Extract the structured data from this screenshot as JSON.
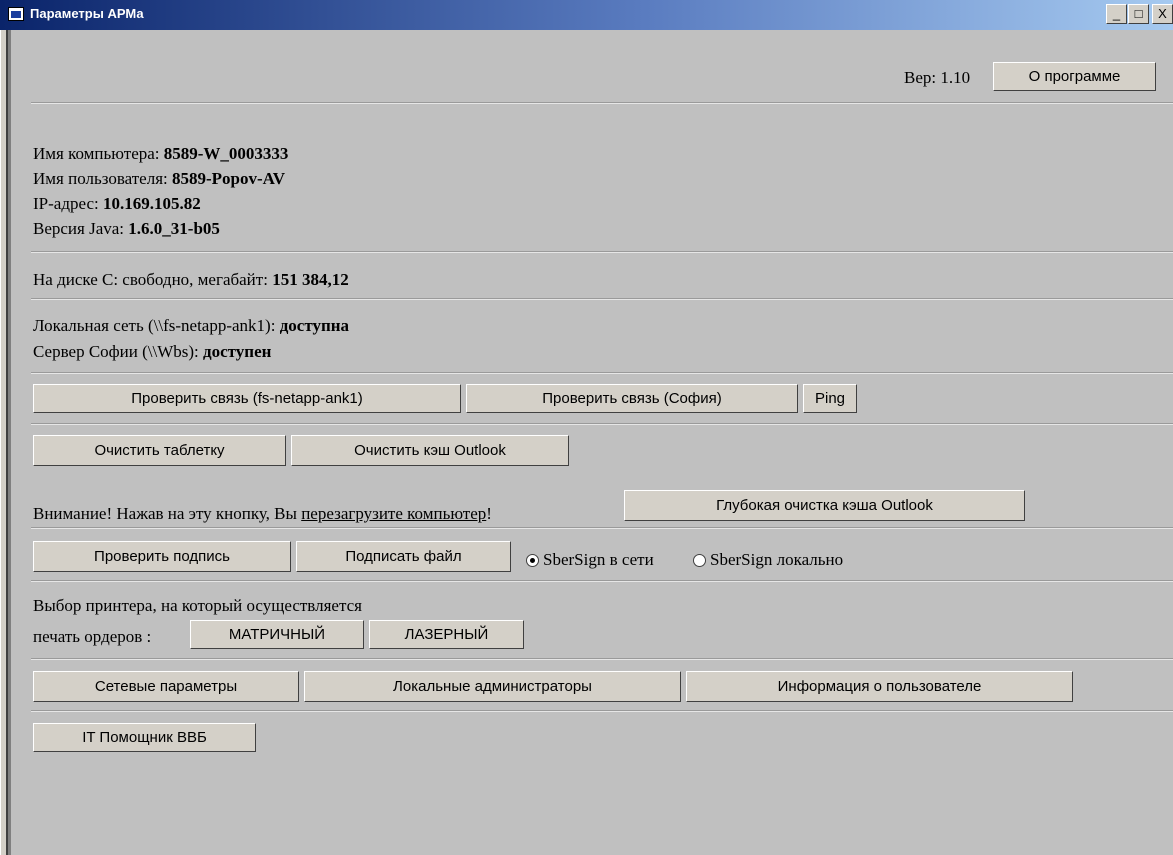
{
  "window": {
    "title": "Параметры АРМа",
    "controls": {
      "minimize": "_",
      "maximize": "□",
      "close": "X"
    }
  },
  "header": {
    "version_label": "Вер: 1.10",
    "about_button": "О программе"
  },
  "info": {
    "computer_name_label": "Имя компьютера: ",
    "computer_name": "8589-W_0003333",
    "user_name_label": "Имя пользователя: ",
    "user_name": "8589-Popov-AV",
    "ip_label": "IP-адрес: ",
    "ip": "10.169.105.82",
    "java_label": "Версия Java: ",
    "java": "1.6.0_31-b05"
  },
  "disk": {
    "label": "На диске C: свободно, мегабайт: ",
    "value": "151 384,12"
  },
  "network": {
    "local_label": "Локальная сеть (\\\\fs-netapp-ank1): ",
    "local_status": "доступна",
    "sofia_label": "Сервер Софии (\\\\Wbs): ",
    "sofia_status": "доступен"
  },
  "buttons_row1": {
    "check_fs": "Проверить связь (fs-netapp-ank1)",
    "check_sofia": "Проверить связь (София)",
    "ping": "Ping"
  },
  "buttons_row2": {
    "clear_tablet": "Очистить таблетку",
    "clear_outlook": "Очистить кэш Outlook"
  },
  "warning": {
    "text_before": "Внимание! Нажав на эту кнопку, Вы ",
    "link": "перезагрузите компьютер",
    "text_after": "!",
    "deep_clean_button": "Глубокая очистка кэша Outlook"
  },
  "sign": {
    "check_button": "Проверить подпись",
    "sign_button": "Подписать файл",
    "radio_network": "SberSign в сети",
    "radio_local": "SberSign локально",
    "selected": "SberSign в сети"
  },
  "printer": {
    "label_line1": "Выбор принтера, на который осуществляется",
    "label_line2": "печать ордеров :",
    "matrix_button": "МАТРИЧНЫЙ",
    "laser_button": "ЛАЗЕРНЫЙ"
  },
  "bottom_buttons": {
    "network_params": "Сетевые параметры",
    "local_admins": "Локальные администраторы",
    "user_info": "Информация о пользователе",
    "it_helper": "IT Помощник ВВБ"
  }
}
